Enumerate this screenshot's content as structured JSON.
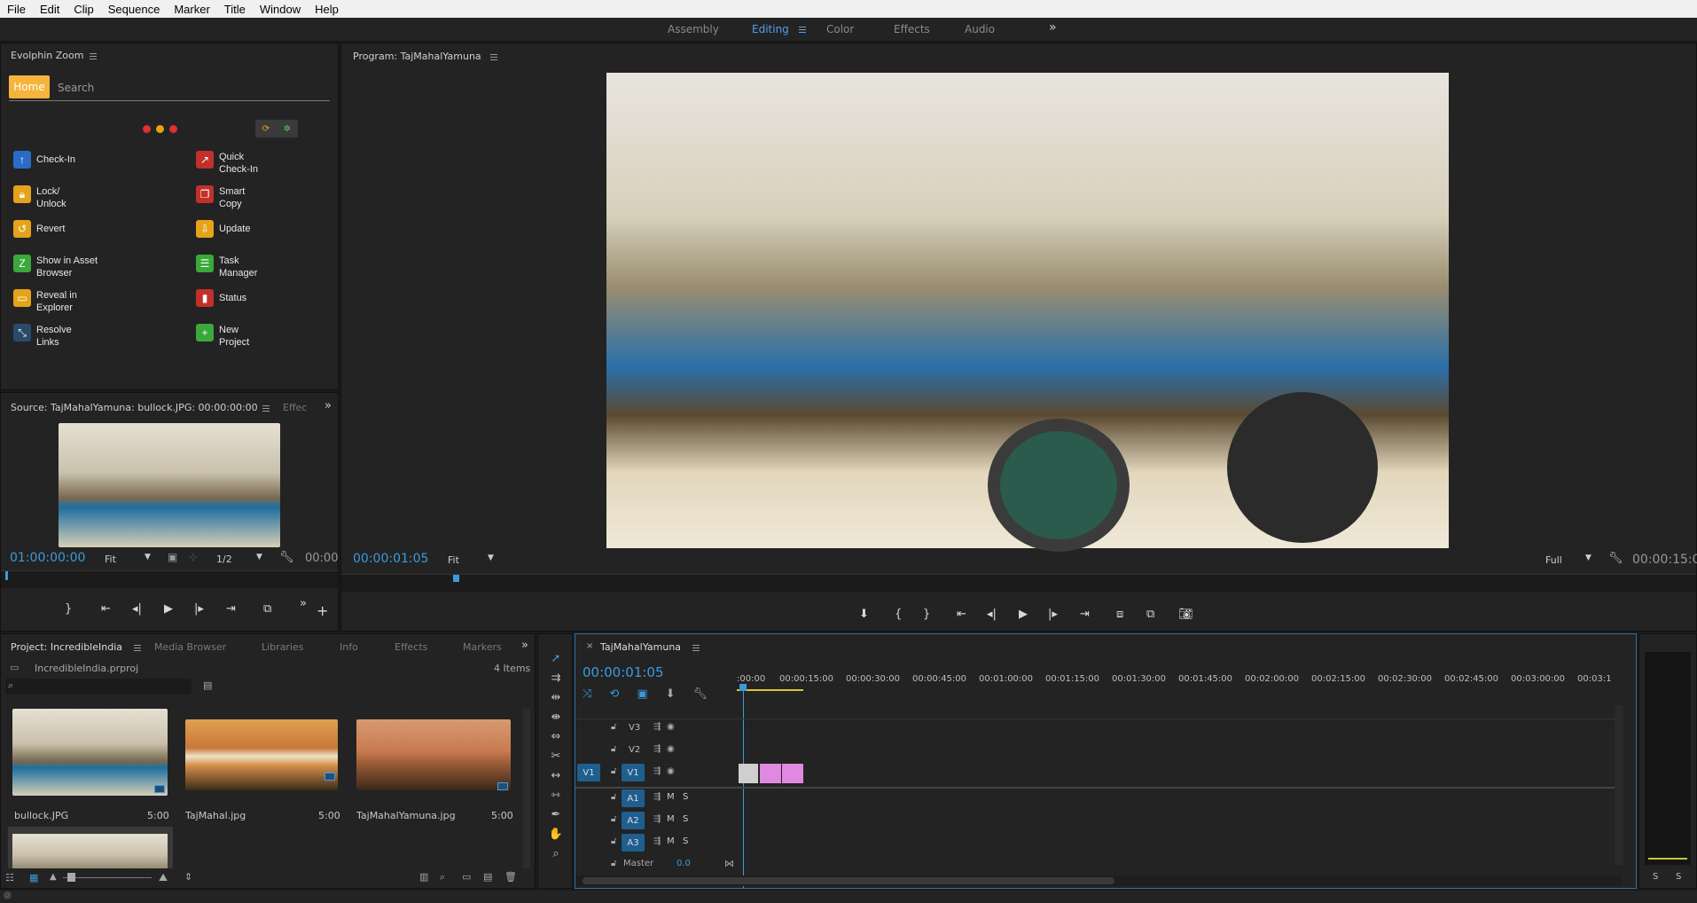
{
  "menu": [
    "File",
    "Edit",
    "Clip",
    "Sequence",
    "Marker",
    "Title",
    "Window",
    "Help"
  ],
  "workspaces": {
    "items": [
      "Assembly",
      "Editing",
      "Color",
      "Effects",
      "Audio"
    ],
    "active": "Editing",
    "more": "»"
  },
  "evolphin": {
    "title": "Evolphin Zoom",
    "tabs": {
      "home": "Home",
      "search": "Search"
    },
    "items": [
      {
        "label": "Check-In",
        "icon": "check-in-icon",
        "color": "#2b6bc7"
      },
      {
        "label": "Quick Check-In",
        "icon": "quick-check-in-icon",
        "color": "#c2302b"
      },
      {
        "label": "Lock/ Unlock",
        "icon": "lock-icon",
        "color": "#e5a31a"
      },
      {
        "label": "Smart Copy",
        "icon": "smart-copy-icon",
        "color": "#c2302b"
      },
      {
        "label": "Revert",
        "icon": "revert-icon",
        "color": "#e5a31a"
      },
      {
        "label": "Update",
        "icon": "update-icon",
        "color": "#e5a31a"
      },
      {
        "label": "Show in Asset Browser",
        "icon": "asset-browser-icon",
        "color": "#3aa83a"
      },
      {
        "label": "Task Manager",
        "icon": "task-manager-icon",
        "color": "#3aa83a"
      },
      {
        "label": "Reveal in Explorer",
        "icon": "explorer-icon",
        "color": "#e5a31a"
      },
      {
        "label": "Status",
        "icon": "status-icon",
        "color": "#c2302b"
      },
      {
        "label": "Resolve Links",
        "icon": "resolve-links-icon",
        "color": "#3a9bdc"
      },
      {
        "label": "New Project",
        "icon": "new-project-icon",
        "color": "#3aa83a"
      }
    ]
  },
  "source": {
    "title": "Source: TajMahalYamuna: bullock.JPG: 00:00:00:00",
    "tab2": "Effec",
    "timecode": "01:00:00:00",
    "fit": "Fit",
    "res": "1/2",
    "end": "00:00"
  },
  "program": {
    "title": "Program: TajMahalYamuna",
    "timecode": "00:00:01:05",
    "fit": "Fit",
    "quality": "Full",
    "end": "00:00:15:0"
  },
  "project": {
    "tabs": [
      "Project: IncredibleIndia",
      "Media Browser",
      "Libraries",
      "Info",
      "Effects",
      "Markers"
    ],
    "file": "IncredibleIndia.prproj",
    "count": "4 Items",
    "items": [
      {
        "name": "bullock.JPG",
        "dur": "5:00"
      },
      {
        "name": "TajMahal.jpg",
        "dur": "5:00"
      },
      {
        "name": "TajMahalYamuna.jpg",
        "dur": "5:00"
      }
    ]
  },
  "timeline": {
    "title": "TajMahalYamuna",
    "timecode": "00:00:01:05",
    "ruler": [
      ":00:00",
      "00:00:15:00",
      "00:00:30:00",
      "00:00:45:00",
      "00:01:00:00",
      "00:01:15:00",
      "00:01:30:00",
      "00:01:45:00",
      "00:02:00:00",
      "00:02:15:00",
      "00:02:30:00",
      "00:02:45:00",
      "00:03:00:00",
      "00:03:1"
    ],
    "video_tracks": [
      "V3",
      "V2",
      "V1"
    ],
    "audio_tracks": [
      "A1",
      "A2",
      "A3"
    ],
    "src_v": "V1",
    "m": "M",
    "s": "S",
    "master": "Master",
    "master_val": "0.0"
  },
  "meter": {
    "s1": "S",
    "s2": "S"
  },
  "colors": {
    "accent": "#3a9bdc",
    "clip": "#e089e0",
    "home": "#f5b43c"
  }
}
